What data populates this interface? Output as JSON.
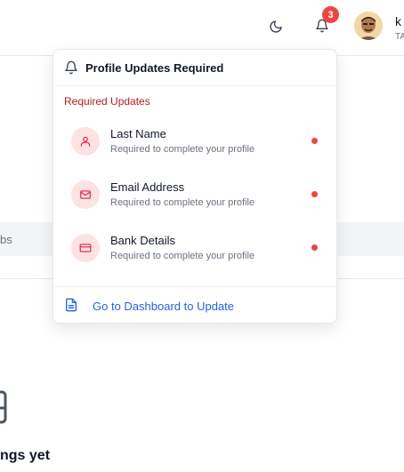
{
  "header": {
    "notification_count": "3",
    "user_name": "k",
    "user_role": "TA"
  },
  "background": {
    "tab_text": "bs",
    "empty_text": "ngs yet"
  },
  "dropdown": {
    "title": "Profile Updates Required",
    "section_label": "Required Updates",
    "items": [
      {
        "title": "Last Name",
        "subtitle": "Required to complete your profile",
        "icon": "user-icon"
      },
      {
        "title": "Email Address",
        "subtitle": "Required to complete your profile",
        "icon": "mail-icon"
      },
      {
        "title": "Bank Details",
        "subtitle": "Required to complete your profile",
        "icon": "credit-card-icon"
      }
    ],
    "footer_label": "Go to Dashboard to Update"
  },
  "colors": {
    "accent_red": "#ef4444",
    "section_red": "#b91c1c",
    "link_blue": "#2563eb",
    "icon_bg": "#fde2e2"
  }
}
